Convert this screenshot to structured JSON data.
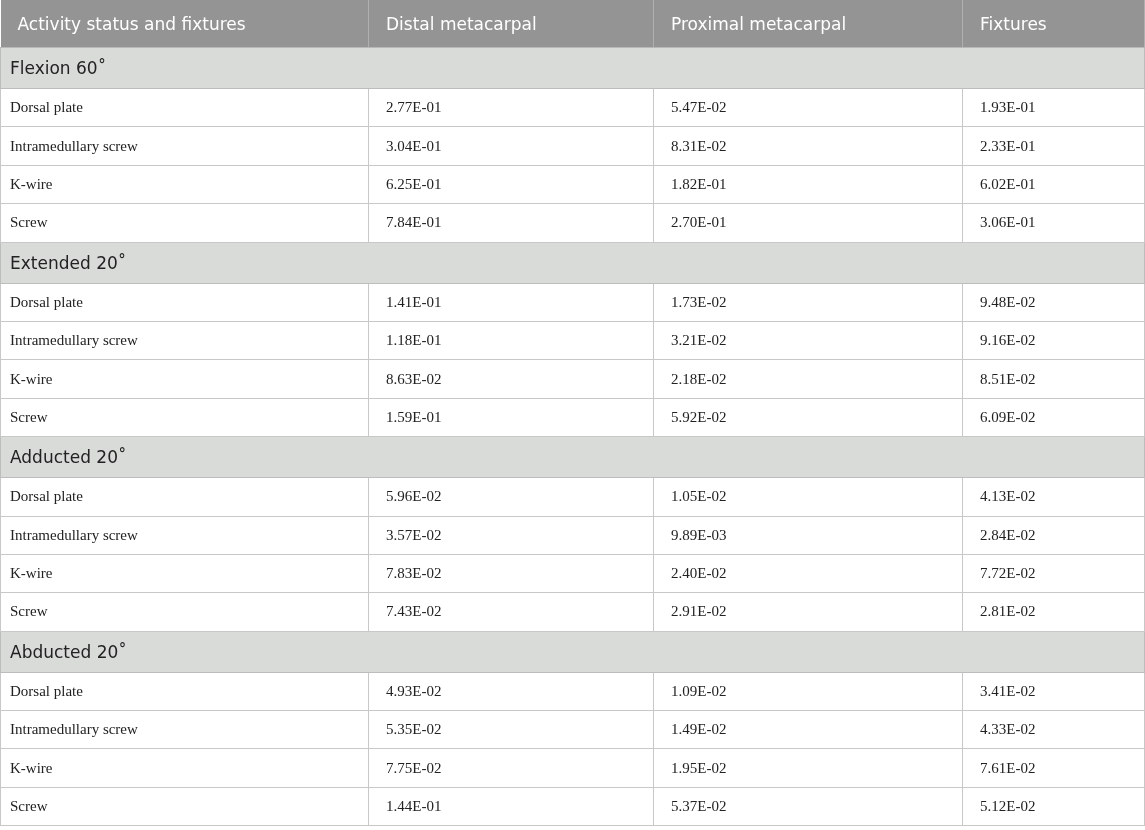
{
  "table": {
    "columns": [
      "Activity status and fixtures",
      "Distal metacarpal",
      "Proximal metacarpal",
      "Fixtures"
    ],
    "groups": [
      {
        "label": "Flexion 60˚",
        "rows": [
          [
            "Dorsal plate",
            "2.77E-01",
            "5.47E-02",
            "1.93E-01"
          ],
          [
            "Intramedullary screw",
            "3.04E-01",
            "8.31E-02",
            "2.33E-01"
          ],
          [
            "K-wire",
            "6.25E-01",
            "1.82E-01",
            "6.02E-01"
          ],
          [
            "Screw",
            "7.84E-01",
            "2.70E-01",
            "3.06E-01"
          ]
        ]
      },
      {
        "label": "Extended 20˚",
        "rows": [
          [
            "Dorsal plate",
            "1.41E-01",
            "1.73E-02",
            "9.48E-02"
          ],
          [
            "Intramedullary screw",
            "1.18E-01",
            "3.21E-02",
            "9.16E-02"
          ],
          [
            "K-wire",
            "8.63E-02",
            "2.18E-02",
            "8.51E-02"
          ],
          [
            "Screw",
            "1.59E-01",
            "5.92E-02",
            "6.09E-02"
          ]
        ]
      },
      {
        "label": "Adducted 20˚",
        "rows": [
          [
            "Dorsal plate",
            "5.96E-02",
            "1.05E-02",
            "4.13E-02"
          ],
          [
            "Intramedullary screw",
            "3.57E-02",
            "9.89E-03",
            "2.84E-02"
          ],
          [
            "K-wire",
            "7.83E-02",
            "2.40E-02",
            "7.72E-02"
          ],
          [
            "Screw",
            "7.43E-02",
            "2.91E-02",
            "2.81E-02"
          ]
        ]
      },
      {
        "label": "Abducted 20˚",
        "rows": [
          [
            "Dorsal plate",
            "4.93E-02",
            "1.09E-02",
            "3.41E-02"
          ],
          [
            "Intramedullary screw",
            "5.35E-02",
            "1.49E-02",
            "4.33E-02"
          ],
          [
            "K-wire",
            "7.75E-02",
            "1.95E-02",
            "7.61E-02"
          ],
          [
            "Screw",
            "1.44E-01",
            "5.37E-02",
            "5.12E-02"
          ]
        ]
      }
    ]
  }
}
